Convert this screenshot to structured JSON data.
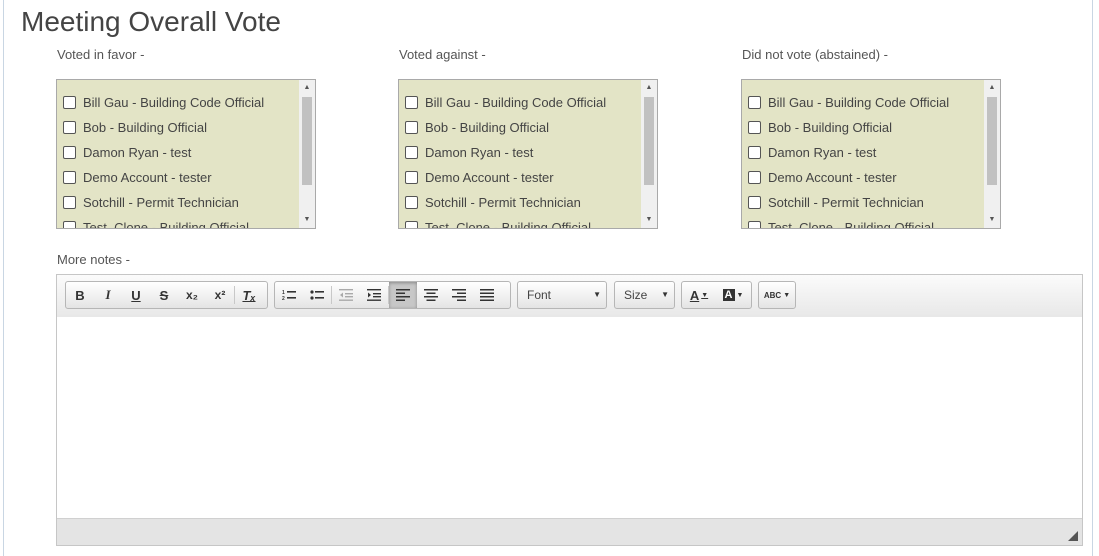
{
  "page": {
    "title": "Meeting Overall Vote"
  },
  "columns": [
    {
      "label": "Voted in favor -"
    },
    {
      "label": "Voted against -"
    },
    {
      "label": "Did not vote (abstained) -"
    }
  ],
  "members": [
    "Bill Gau - Building Code Official",
    "Bob - Building Official",
    "Damon Ryan - test",
    "Demo Account - tester",
    "Sotchill - Permit Technician",
    "Test_Clone - Building Official"
  ],
  "notes": {
    "label": "More notes -",
    "content": ""
  },
  "toolbar": {
    "bold": "B",
    "italic": "I",
    "underline": "U",
    "strike": "S",
    "subscript": "x₂",
    "superscript": "x²",
    "remove_format": "Tₓ",
    "font_combo": "Font",
    "size_combo": "Size",
    "text_color": "A",
    "bg_color": "A",
    "spellcheck": "ABC"
  },
  "icons": [
    "chevron-up-icon",
    "chevron-down-icon",
    "numbered-list-icon",
    "bullet-list-icon",
    "outdent-icon",
    "indent-icon",
    "align-left-icon",
    "align-center-icon",
    "align-right-icon",
    "justify-icon",
    "resize-grip-icon"
  ]
}
